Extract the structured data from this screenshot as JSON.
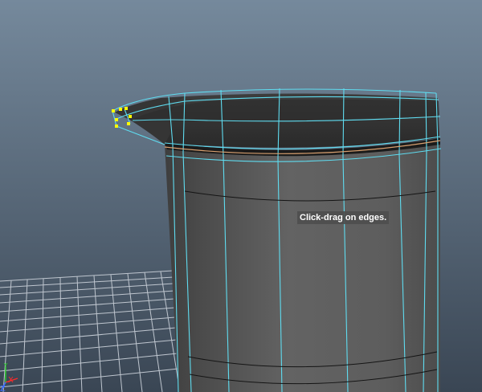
{
  "viewport": {
    "tooltip": "Click-drag on edges.",
    "background": {
      "top": "#75899c",
      "bottom": "#3a4654"
    },
    "colors": {
      "wireframe": "#5fdcf0",
      "grid": "#bfc6cf",
      "mesh_body": "#5c5c5c",
      "selection": "#ffff00",
      "highlight_edge": "#d8a070"
    }
  },
  "axis_gizmo": {
    "x_label": "X",
    "y_label": "Y",
    "z_label": "Z",
    "x_color": "#ff2a2a",
    "y_color": "#28d028",
    "z_color": "#3a6cff"
  }
}
